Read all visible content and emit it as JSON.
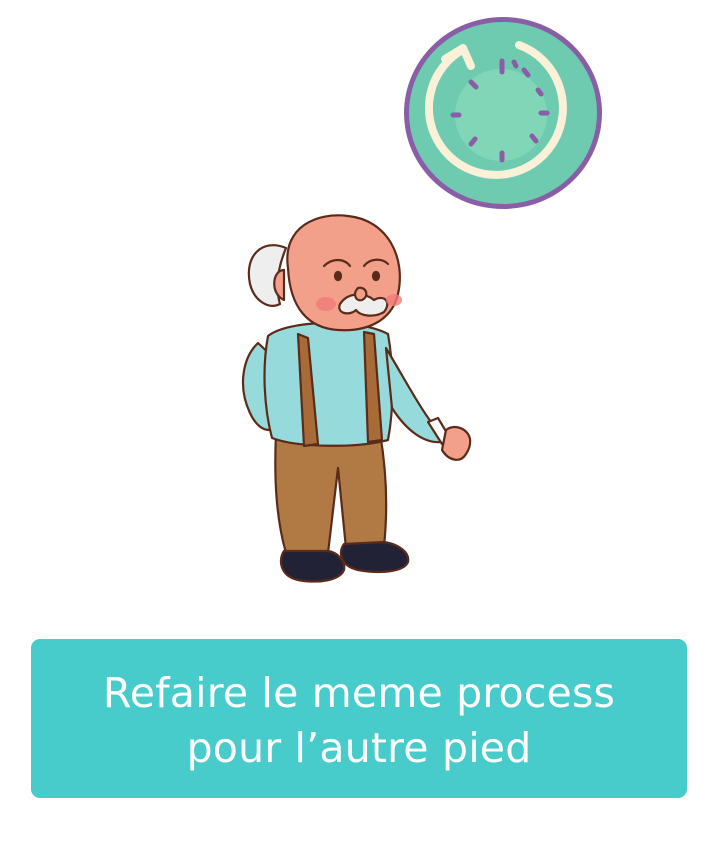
{
  "icons": {
    "timer": "restart-timer-icon",
    "character": "elderly-man-illustration"
  },
  "colors": {
    "caption_background": "#48cbcb",
    "caption_text": "#ffffff",
    "timer_ring": "#8a5ea6",
    "timer_fill": "#6fcbb0",
    "timer_inner": "#82d6b8",
    "timer_arrow": "#fbf1d8",
    "timer_ticks": "#8a5ea6"
  },
  "caption": {
    "line1": "Refaire le meme process",
    "line2": "pour l’autre pied"
  }
}
